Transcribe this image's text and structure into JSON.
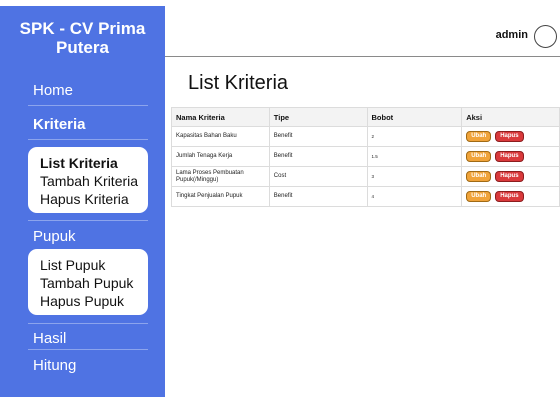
{
  "app": {
    "brand_title": "SPK - CV Prima Putera"
  },
  "sidebar": {
    "home": "Home",
    "kriteria": "Kriteria",
    "kriteria_sub": [
      "List Kriteria",
      "Tambah Kriteria",
      "Hapus Kriteria"
    ],
    "pupuk": "Pupuk",
    "pupuk_sub": [
      "List Pupuk",
      "Tambah Pupuk",
      "Hapus Pupuk"
    ],
    "hasil": "Hasil",
    "hitung": "Hitung"
  },
  "header": {
    "user": "admin"
  },
  "main": {
    "title": "List Kriteria",
    "columns": [
      "Nama Kriteria",
      "Tipe",
      "Bobot",
      "Aksi"
    ],
    "rows": [
      {
        "nama": "Kapasitas Bahan Baku",
        "tipe": "Benefit",
        "bobot": "2"
      },
      {
        "nama": "Jumlah Tenaga Kerja",
        "tipe": "Benefit",
        "bobot": "1.5"
      },
      {
        "nama": "Lama Proses Pembuatan Pupuk(/Minggu)",
        "tipe": "Cost",
        "bobot": "3"
      },
      {
        "nama": "Tingkat Penjualan Pupuk",
        "tipe": "Benefit",
        "bobot": "4"
      }
    ],
    "action_edit": "Ubah",
    "action_delete": "Hapus"
  },
  "colors": {
    "sidebar_bg": "#4f73e3",
    "edit_button": "#f0a33a",
    "delete_button": "#d9393b"
  }
}
